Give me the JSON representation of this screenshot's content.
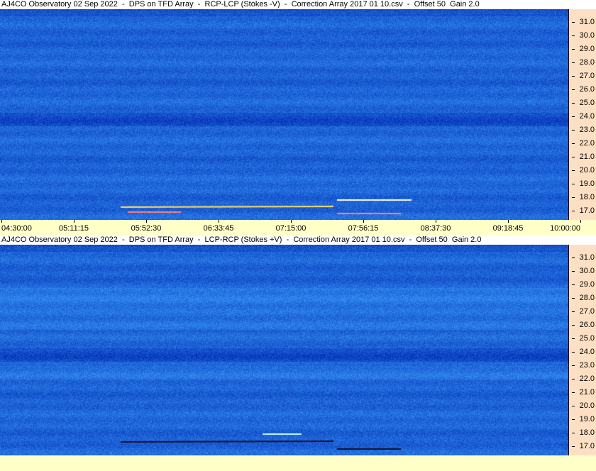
{
  "top_panel": {
    "title": "AJ4CO Observatory 02 Sep 2022  -  DPS on TFD Array  -  RCP-LCP (Stokes -V)  -  Correction Array 2017 01 10.csv  -  Offset 50  Gain 2.0",
    "freq_ticks": [
      "31.0",
      "30.0",
      "29.0",
      "28.0",
      "27.0",
      "26.0",
      "25.0",
      "24.0",
      "23.0",
      "22.0",
      "21.0",
      "20.0",
      "19.0",
      "18.0",
      "17.0"
    ],
    "time_ticks": [
      "04:30:00",
      "05:11:15",
      "05:52:30",
      "06:33:45",
      "07:15:00",
      "07:56:15",
      "08:37:30",
      "09:18:45",
      "10:00:00"
    ],
    "trace_color": "#ffe060"
  },
  "bottom_panel": {
    "title": "AJ4CO Observatory 02 Sep 2022  -  DPS on TFD Array  -  LCP-RCP (Stokes +V)  -  Correction Array 2017 01 10.csv  -  Offset 50  Gain 2.0",
    "freq_ticks": [
      "31.0",
      "30.0",
      "29.0",
      "28.0",
      "27.0",
      "26.0",
      "25.0",
      "24.0",
      "23.0",
      "22.0",
      "21.0",
      "20.0",
      "19.0",
      "18.0",
      "17.0"
    ],
    "trace_color": "#101028"
  },
  "colors": {
    "background": "#ffffc8",
    "axis_panel": "#fde0c4",
    "spectrogram_base": "#2a6cd8"
  }
}
